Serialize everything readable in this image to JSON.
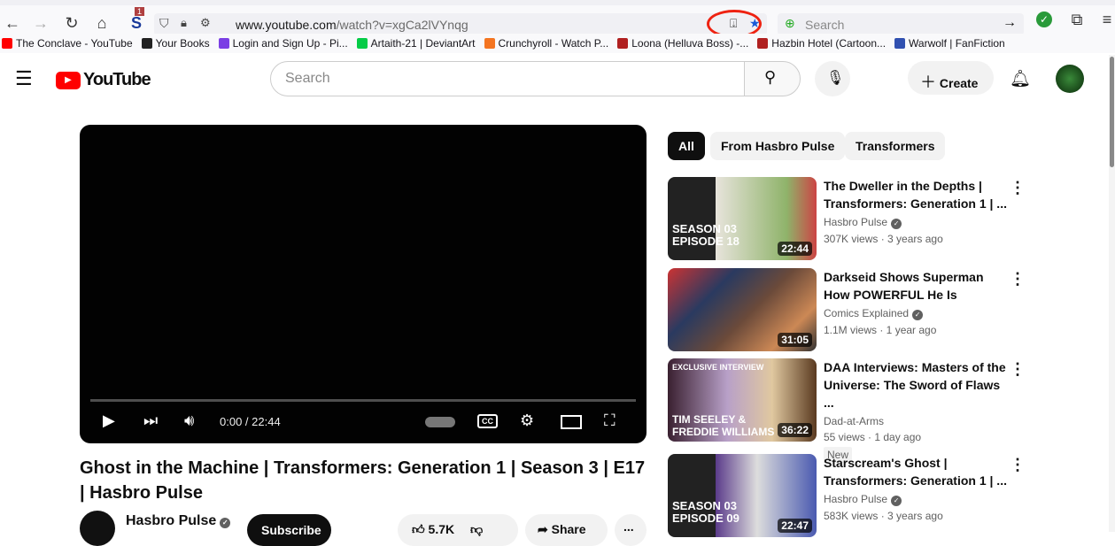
{
  "browser": {
    "url_domain": "www.youtube.com",
    "url_path": "/watch?v=xgCa2lVYnqg",
    "search_placeholder": "Search",
    "badge_count": "1",
    "bookmarks": [
      {
        "label": "The Conclave - YouTube",
        "color": "#ff0000"
      },
      {
        "label": "Your Books",
        "color": "#222222"
      },
      {
        "label": "Login and Sign Up - Pi...",
        "color": "#7b3fe4"
      },
      {
        "label": "Artaith-21 | DeviantArt",
        "color": "#05cc47"
      },
      {
        "label": "Crunchyroll - Watch P...",
        "color": "#f47521"
      },
      {
        "label": "Loona (Helluva Boss) -...",
        "color": "#b02020"
      },
      {
        "label": "Hazbin Hotel (Cartoon...",
        "color": "#b02020"
      },
      {
        "label": "Warwolf | FanFiction",
        "color": "#3050b0"
      }
    ]
  },
  "youtube": {
    "logo": "YouTube",
    "search_placeholder": "Search",
    "create_label": "Create"
  },
  "player": {
    "time": "0:00 / 22:44",
    "progress": 0
  },
  "video": {
    "title": "Ghost in the Machine | Transformers: Generation 1 | Season 3 | E17 | Hasbro Pulse",
    "channel": "Hasbro Pulse",
    "subscribe": "Subscribe",
    "likes": "5.7K",
    "share": "Share",
    "more": "..."
  },
  "chips": [
    "All",
    "From Hasbro Pulse",
    "Transformers"
  ],
  "recommendations": [
    {
      "title": "The Dweller in the Depths | Transformers: Generation 1 | ...",
      "channel": "Hasbro Pulse",
      "verified": true,
      "meta": "307K views · 3 years ago",
      "duration": "22:44",
      "overlay": "SEASON 03\nEPISODE 18",
      "bg": "linear-gradient(90deg,#222 0 32%,#e8e4dc 32%,#8fb36a 80%,#c44 100%)"
    },
    {
      "title": "Darkseid Shows Superman How POWERFUL He Is",
      "channel": "Comics Explained",
      "verified": true,
      "meta": "1.1M views · 1 year ago",
      "duration": "31:05",
      "overlay": "",
      "bg": "linear-gradient(135deg,#c33 0,#2a3a60 30%,#6b4a3a 55%,#c85 80%,#333 100%)"
    },
    {
      "title": "DAA Interviews: Masters of the Universe: The Sword of Flaws ...",
      "channel": "Dad-at-Arms",
      "verified": false,
      "meta": "55 views · 1 day ago",
      "badge": "New",
      "duration": "36:22",
      "overlay": "EXCLUSIVE INTERVIEW",
      "overlay2": "TIM SEELEY &\nFREDDIE WILLIAMS",
      "bg": "linear-gradient(90deg,#3a2030 0,#b8a0c8 40%,#e0c8a0 70%,#5a3a20 100%)"
    },
    {
      "title": "Starscream's Ghost | Transformers: Generation 1 | ...",
      "channel": "Hasbro Pulse",
      "verified": true,
      "meta": "583K views · 3 years ago",
      "duration": "22:47",
      "overlay": "SEASON 03\nEPISODE 09",
      "bg": "linear-gradient(90deg,#222 0 32%,#5a3a8a 32%,#ddd 60%,#4a5ab0 100%)"
    }
  ]
}
